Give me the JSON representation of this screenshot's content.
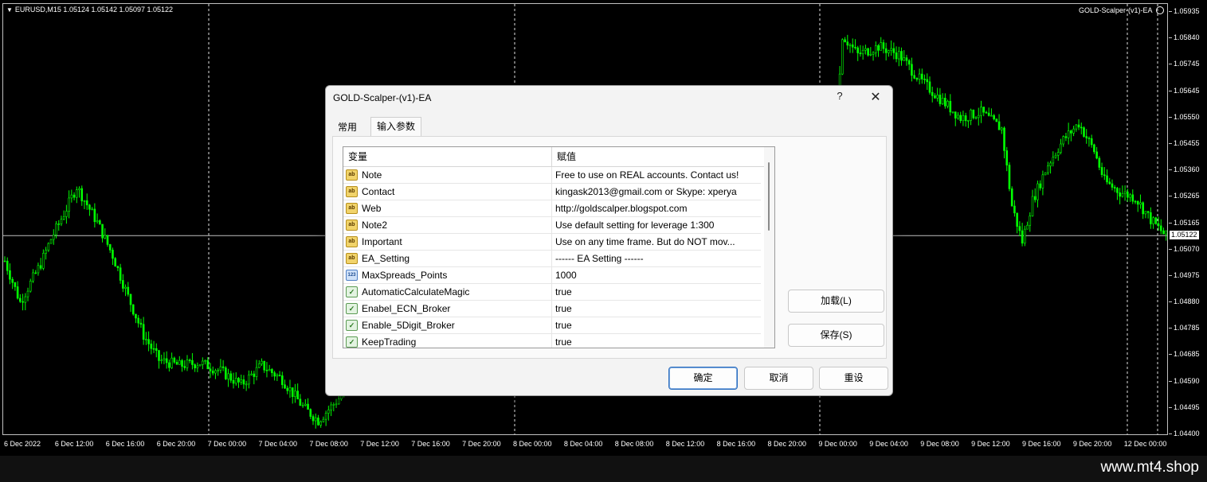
{
  "chart": {
    "symbol_info": "EURUSD,M15  1.05124 1.05142 1.05097 1.05122",
    "ea_label": "GOLD-Scalper-(v1)-EA",
    "current_price": "1.05122",
    "price_ticks": [
      "1.05935",
      "1.05840",
      "1.05745",
      "1.05645",
      "1.05550",
      "1.05455",
      "1.05360",
      "1.05265",
      "1.05165",
      "1.05070",
      "1.04975",
      "1.04880",
      "1.04785",
      "1.04685",
      "1.04590",
      "1.04495",
      "1.04400"
    ],
    "time_ticks": [
      "6 Dec 2022",
      "6 Dec 12:00",
      "6 Dec 16:00",
      "6 Dec 20:00",
      "7 Dec 00:00",
      "7 Dec 04:00",
      "7 Dec 08:00",
      "7 Dec 12:00",
      "7 Dec 16:00",
      "7 Dec 20:00",
      "8 Dec 00:00",
      "8 Dec 04:00",
      "8 Dec 08:00",
      "8 Dec 12:00",
      "8 Dec 16:00",
      "8 Dec 20:00",
      "9 Dec 00:00",
      "9 Dec 04:00",
      "9 Dec 08:00",
      "9 Dec 12:00",
      "9 Dec 16:00",
      "9 Dec 20:00",
      "12 Dec 00:00"
    ],
    "candle_color": "#00ff00",
    "price_anchors": [
      [
        0,
        1.0503
      ],
      [
        3,
        1.0488
      ],
      [
        7,
        1.0502
      ],
      [
        9,
        1.0511
      ],
      [
        12,
        1.0522
      ],
      [
        14,
        1.053
      ],
      [
        18,
        1.0517
      ],
      [
        21,
        1.0505
      ],
      [
        24,
        1.049
      ],
      [
        27,
        1.0476
      ],
      [
        30,
        1.0467
      ],
      [
        34,
        1.0465
      ],
      [
        38,
        1.0466
      ],
      [
        42,
        1.0463
      ],
      [
        46,
        1.0458
      ],
      [
        50,
        1.0465
      ],
      [
        54,
        1.046
      ],
      [
        58,
        1.045
      ],
      [
        61,
        1.0445
      ],
      [
        65,
        1.0453
      ],
      [
        70,
        1.0463
      ],
      [
        80,
        1.047
      ],
      [
        100,
        1.0472
      ],
      [
        125,
        1.0476
      ],
      [
        140,
        1.0475
      ],
      [
        155,
        1.0476
      ],
      [
        160,
        1.05
      ],
      [
        163,
        1.0585
      ],
      [
        166,
        1.0578
      ],
      [
        170,
        1.0581
      ],
      [
        174,
        1.0578
      ],
      [
        178,
        1.0569
      ],
      [
        182,
        1.0562
      ],
      [
        186,
        1.0555
      ],
      [
        190,
        1.0557
      ],
      [
        194,
        1.0551
      ],
      [
        196,
        1.0523
      ],
      [
        198,
        1.051
      ],
      [
        200,
        1.0525
      ],
      [
        203,
        1.0538
      ],
      [
        206,
        1.0547
      ],
      [
        209,
        1.0553
      ],
      [
        212,
        1.0543
      ],
      [
        214,
        1.0532
      ],
      [
        217,
        1.0528
      ],
      [
        220,
        1.0526
      ],
      [
        223,
        1.0518
      ],
      [
        226,
        1.0512
      ]
    ]
  },
  "dialog": {
    "title": "GOLD-Scalper-(v1)-EA",
    "help": "?",
    "close": "✕",
    "tabs": [
      "常用",
      "输入参数"
    ],
    "columns": [
      "变量",
      "赋值"
    ],
    "rows": [
      {
        "type": "ab",
        "name": "Note",
        "value": "Free to use on REAL accounts. Contact us!"
      },
      {
        "type": "ab",
        "name": "Contact",
        "value": "kingask2013@gmail.com or Skype: xperya"
      },
      {
        "type": "ab",
        "name": "Web",
        "value": "http://goldscalper.blogspot.com"
      },
      {
        "type": "ab",
        "name": "Note2",
        "value": "Use default setting for leverage 1:300"
      },
      {
        "type": "ab",
        "name": "Important",
        "value": "Use on any time frame. But do NOT mov..."
      },
      {
        "type": "ab",
        "name": "EA_Setting",
        "value": "------ EA Setting ------"
      },
      {
        "type": "123",
        "name": "MaxSpreads_Points",
        "value": "1000"
      },
      {
        "type": "bool",
        "name": "AutomaticCalculateMagic",
        "value": "true"
      },
      {
        "type": "bool",
        "name": "Enabel_ECN_Broker",
        "value": "true"
      },
      {
        "type": "bool",
        "name": "Enable_5Digit_Broker",
        "value": "true"
      },
      {
        "type": "bool",
        "name": "KeepTrading",
        "value": "true"
      }
    ],
    "icon_labels": {
      "ab": "ab",
      "123": "123",
      "bool": "✓"
    },
    "load_button": "加载(L)",
    "save_button": "保存(S)",
    "ok_button": "确定",
    "cancel_button": "取消",
    "reset_button": "重设"
  },
  "footer": {
    "watermark": "www.mt4.shop"
  }
}
